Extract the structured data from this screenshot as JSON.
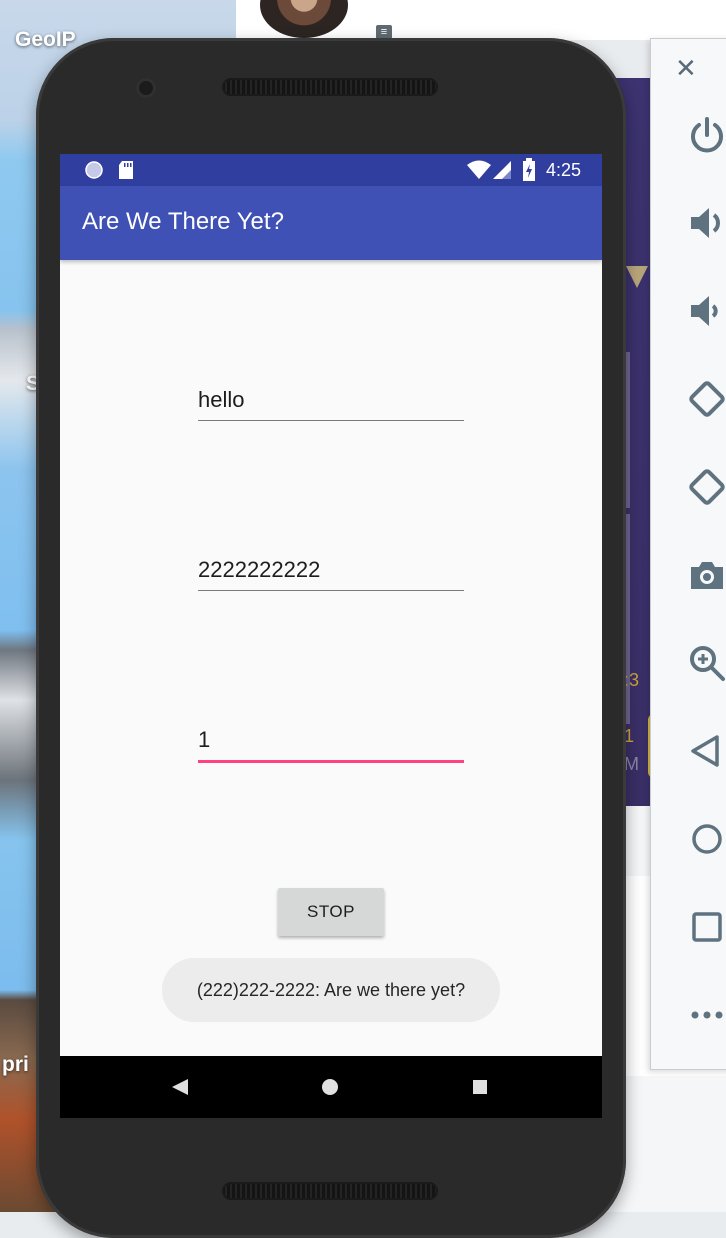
{
  "desktop": {
    "labels": [
      "GeoIP",
      "S",
      "pri"
    ]
  },
  "purple_panel": {
    "fragment_1": ":3",
    "fragment_2": "1",
    "fragment_3": "M"
  },
  "emulator_toolbar": {
    "items": [
      "close-icon",
      "power-icon",
      "volume-up-icon",
      "volume-down-icon",
      "rotate-left-icon",
      "rotate-right-icon",
      "camera-icon",
      "zoom-icon",
      "back-icon",
      "home-icon",
      "overview-icon",
      "more-icon"
    ]
  },
  "status_bar": {
    "time": "4:25"
  },
  "app": {
    "title": "Are We There Yet?",
    "fields": {
      "message": "hello",
      "phone": "2222222222",
      "interval": "1"
    },
    "stop_label": "STOP",
    "toast": "(222)222-2222: Are we there yet?"
  },
  "colors": {
    "app_bar": "#3f51b5",
    "status_bar": "#303f9f",
    "accent": "#ff4081"
  }
}
